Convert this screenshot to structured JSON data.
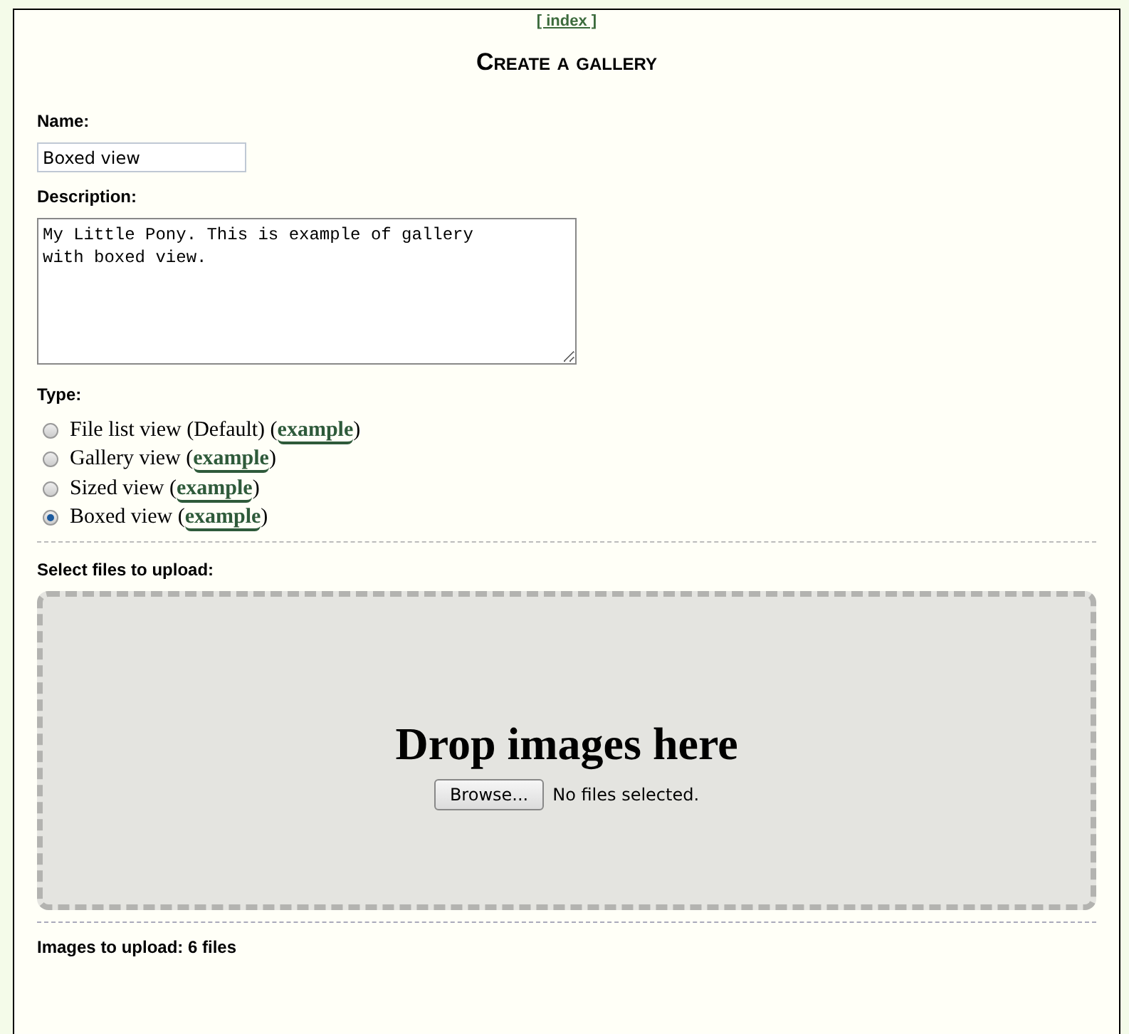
{
  "nav_link": "[ index ]",
  "title": "Create a gallery",
  "name_field": {
    "label": "Name:",
    "value": "Boxed view"
  },
  "description_field": {
    "label": "Description:",
    "value": "My Little Pony. This is example of gallery\nwith boxed view."
  },
  "type": {
    "label": "Type:",
    "options": [
      {
        "label": "File list view (Default) (",
        "link": "example",
        "after_link": ")",
        "selected": false
      },
      {
        "label": "Gallery view (",
        "link": "example",
        "after_link": ")",
        "selected": false
      },
      {
        "label": "Sized view (",
        "link": "example",
        "after_link": ")",
        "selected": false
      },
      {
        "label": "Boxed view (",
        "link": "example",
        "after_link": ")",
        "selected": true
      }
    ]
  },
  "upload": {
    "label": "Select files to upload:",
    "drop_text": "Drop images here",
    "browse_button": "Browse...",
    "file_status": "No files selected."
  },
  "images_to_upload": "Images to upload: 6 files"
}
